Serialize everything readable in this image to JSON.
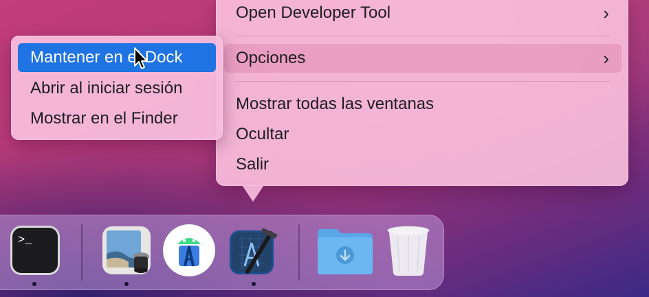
{
  "context_menu": {
    "items": [
      {
        "label": "Open Developer Tool",
        "has_submenu": true
      },
      {
        "label": "Opciones",
        "has_submenu": true,
        "highlighted": true
      },
      {
        "label": "Mostrar todas las ventanas"
      },
      {
        "label": "Ocultar"
      },
      {
        "label": "Salir"
      }
    ],
    "chevron": "›"
  },
  "submenu": {
    "items": [
      {
        "label": "Mantener en el Dock",
        "selected": true
      },
      {
        "label": "Abrir al iniciar sesión"
      },
      {
        "label": "Mostrar en el Finder"
      }
    ]
  },
  "dock": {
    "apps": [
      {
        "name": "terminal-icon",
        "running": true,
        "prompt": ">_"
      },
      {
        "name": "preview-icon",
        "running": true
      },
      {
        "name": "android-studio-icon",
        "running": false
      },
      {
        "name": "xcode-icon",
        "running": true
      },
      {
        "name": "downloads-folder-icon",
        "running": false
      },
      {
        "name": "trash-icon",
        "running": false
      }
    ]
  },
  "colors": {
    "selection": "#1f73e3",
    "menu_bg": "#f7bcdc",
    "text": "#1d1d1f"
  }
}
